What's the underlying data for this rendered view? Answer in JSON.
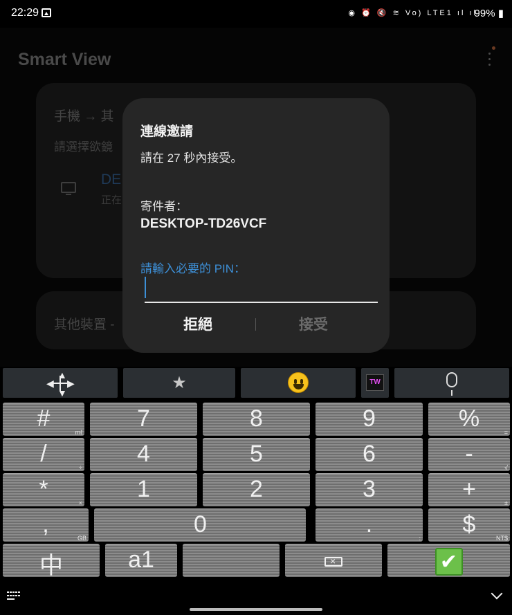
{
  "status_bar": {
    "time": "22:29",
    "icons": [
      "gallery-icon",
      "alarm-icon",
      "mute-icon",
      "wifi-icon",
      "volte-icon",
      "signal-icon"
    ],
    "icons_text": "◉ ⏰ 🔇 ≋ Vo) LTE1 ıl ıl",
    "battery": "99%"
  },
  "background_app": {
    "title": "Smart View",
    "card": {
      "title": "手機 → 其",
      "subtitle": "請選擇欲鏡",
      "device_name": "DE",
      "device_status": "正在"
    },
    "card2": {
      "title": "其他裝置 -"
    }
  },
  "dialog": {
    "title": "連線邀請",
    "message": "請在 27 秒內接受。",
    "sender_label": "寄件者：",
    "sender_name": "DESKTOP-TD26VCF",
    "pin_label": "請輸入必要的 PIN：",
    "pin_value": "",
    "reject_label": "拒絕",
    "accept_label": "接受",
    "accent_color": "#3d8fd6"
  },
  "keyboard": {
    "toolbar": [
      "move-icon",
      "star-icon",
      "emoji-icon",
      "tw-icon",
      "mic-icon"
    ],
    "tw_label": "TW",
    "rows": [
      [
        {
          "main": "#",
          "sub": "mℓ"
        },
        {
          "main": "7",
          "sub": ""
        },
        {
          "main": "8",
          "sub": ""
        },
        {
          "main": "9",
          "sub": ""
        },
        {
          "main": "%",
          "sub": "="
        }
      ],
      [
        {
          "main": "/",
          "sub": "÷"
        },
        {
          "main": "4",
          "sub": ""
        },
        {
          "main": "5",
          "sub": ""
        },
        {
          "main": "6",
          "sub": ""
        },
        {
          "main": "-",
          "sub": "√"
        }
      ],
      [
        {
          "main": "*",
          "sub": "×"
        },
        {
          "main": "1",
          "sub": ""
        },
        {
          "main": "2",
          "sub": ""
        },
        {
          "main": "3",
          "sub": ""
        },
        {
          "main": "+",
          "sub": "±"
        }
      ],
      [
        {
          "main": ",",
          "sub": "GB"
        },
        {
          "main": "0",
          "sub": ""
        },
        {
          "main": ".",
          "sub": ":"
        },
        {
          "main": "$",
          "sub": "NT$"
        }
      ],
      [
        {
          "main": "中",
          "sub": ""
        },
        {
          "main": "a1",
          "sub": ""
        },
        {
          "main": "",
          "sub": ""
        },
        {
          "main": "",
          "sub": ""
        },
        {
          "main": "✔",
          "sub": ""
        }
      ]
    ],
    "key_names": [
      "hash-key",
      "seven-key",
      "eight-key",
      "nine-key",
      "percent-key",
      "slash-key",
      "four-key",
      "five-key",
      "six-key",
      "minus-key",
      "asterisk-key",
      "one-key",
      "two-key",
      "three-key",
      "plus-key",
      "comma-key",
      "zero-key",
      "period-key",
      "dollar-key",
      "chinese-mode-key",
      "alphanumeric-mode-key",
      "space-key",
      "backspace-key",
      "enter-key"
    ]
  }
}
